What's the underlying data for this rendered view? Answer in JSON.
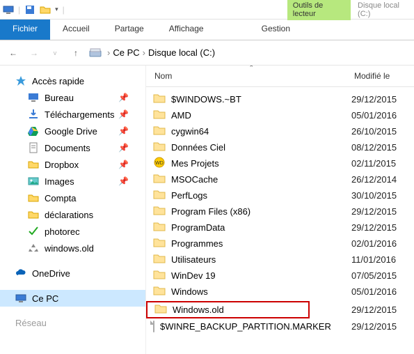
{
  "titlebar": {
    "context_tab": "Outils de lecteur",
    "drive": "Disque local (C:)"
  },
  "ribbon": {
    "file": "Fichier",
    "home": "Accueil",
    "share": "Partage",
    "view": "Affichage",
    "manage": "Gestion"
  },
  "breadcrumb": {
    "root": "Ce PC",
    "drive": "Disque local (C:)"
  },
  "columns": {
    "name": "Nom",
    "modified": "Modifié le"
  },
  "nav": {
    "quick": "Accès rapide",
    "items": [
      {
        "label": "Bureau",
        "pinned": true,
        "icon": "desktop"
      },
      {
        "label": "Téléchargements",
        "pinned": true,
        "icon": "downloads"
      },
      {
        "label": "Google Drive",
        "pinned": true,
        "icon": "gdrive"
      },
      {
        "label": "Documents",
        "pinned": true,
        "icon": "docs"
      },
      {
        "label": "Dropbox",
        "pinned": true,
        "icon": "folder"
      },
      {
        "label": "Images",
        "pinned": true,
        "icon": "images"
      },
      {
        "label": "Compta",
        "pinned": false,
        "icon": "folder"
      },
      {
        "label": "déclarations",
        "pinned": false,
        "icon": "folder"
      },
      {
        "label": "photorec",
        "pinned": false,
        "icon": "check"
      },
      {
        "label": "windows.old",
        "pinned": false,
        "icon": "recycle"
      }
    ],
    "onedrive": "OneDrive",
    "thispc": "Ce PC",
    "network": "Réseau"
  },
  "files": [
    {
      "name": "$WINDOWS.~BT",
      "date": "29/12/2015",
      "type": "folder"
    },
    {
      "name": "AMD",
      "date": "05/01/2016",
      "type": "folder"
    },
    {
      "name": "cygwin64",
      "date": "26/10/2015",
      "type": "folder"
    },
    {
      "name": "Données Ciel",
      "date": "08/12/2015",
      "type": "folder"
    },
    {
      "name": "Mes Projets",
      "date": "02/11/2015",
      "type": "wd"
    },
    {
      "name": "MSOCache",
      "date": "26/12/2014",
      "type": "folder"
    },
    {
      "name": "PerfLogs",
      "date": "30/10/2015",
      "type": "folder"
    },
    {
      "name": "Program Files (x86)",
      "date": "29/12/2015",
      "type": "folder"
    },
    {
      "name": "ProgramData",
      "date": "29/12/2015",
      "type": "folder"
    },
    {
      "name": "Programmes",
      "date": "02/01/2016",
      "type": "folder"
    },
    {
      "name": "Utilisateurs",
      "date": "11/01/2016",
      "type": "folder"
    },
    {
      "name": "WinDev 19",
      "date": "07/05/2015",
      "type": "folder"
    },
    {
      "name": "Windows",
      "date": "05/01/2016",
      "type": "folder"
    },
    {
      "name": "Windows.old",
      "date": "29/12/2015",
      "type": "folder",
      "highlight": true
    },
    {
      "name": "$WINRE_BACKUP_PARTITION.MARKER",
      "date": "29/12/2015",
      "type": "file"
    }
  ]
}
